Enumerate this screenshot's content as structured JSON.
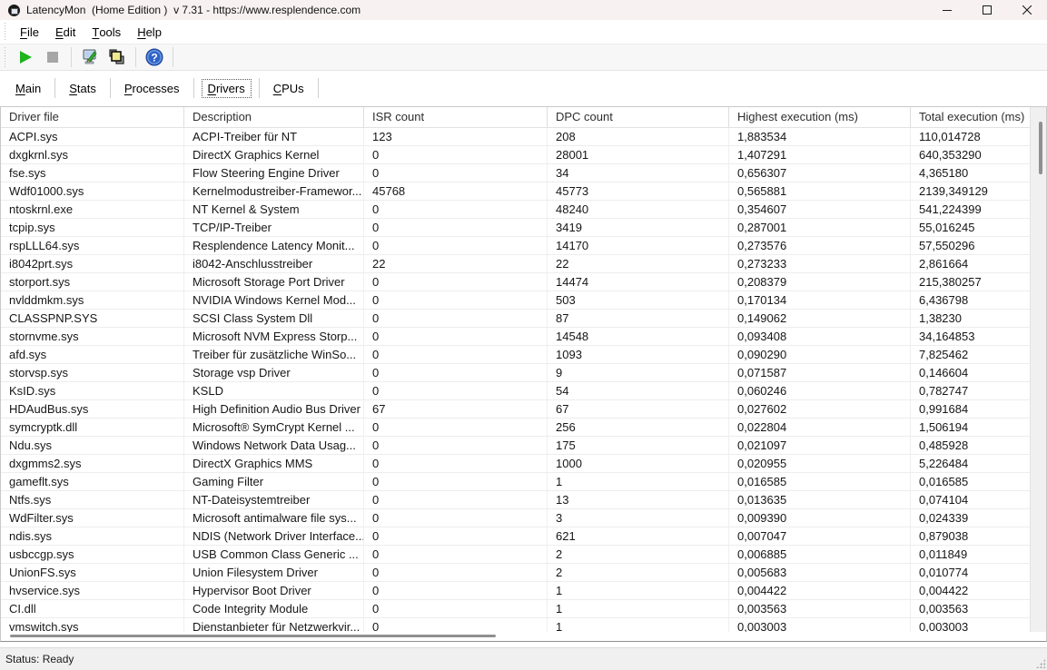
{
  "window": {
    "title": "LatencyMon  (Home Edition )  v 7.31 - https://www.resplendence.com"
  },
  "menubar": {
    "items": [
      {
        "label": "File"
      },
      {
        "label": "Edit"
      },
      {
        "label": "Tools"
      },
      {
        "label": "Help"
      }
    ]
  },
  "toolbar": {
    "buttons": [
      "start-monitor",
      "stop-monitor",
      "options",
      "report",
      "help"
    ],
    "colors": {
      "play_green": "#1eb41e",
      "stop_gray": "#a6a6a6",
      "help_blue": "#2e63c8",
      "report_yellow": "#f0e98f"
    }
  },
  "tabs": [
    {
      "label": "Main",
      "active": false
    },
    {
      "label": "Stats",
      "active": false
    },
    {
      "label": "Processes",
      "active": false
    },
    {
      "label": "Drivers",
      "active": true
    },
    {
      "label": "CPUs",
      "active": false
    }
  ],
  "table": {
    "columns": [
      "Driver file",
      "Description",
      "ISR count",
      "DPC count",
      "Highest execution (ms)",
      "Total execution (ms)"
    ],
    "rows": [
      [
        "ACPI.sys",
        "ACPI-Treiber für NT",
        "123",
        "208",
        "1,883534",
        "110,014728"
      ],
      [
        "dxgkrnl.sys",
        "DirectX Graphics Kernel",
        "0",
        "28001",
        "1,407291",
        "640,353290"
      ],
      [
        "fse.sys",
        "Flow Steering Engine Driver",
        "0",
        "34",
        "0,656307",
        "4,365180"
      ],
      [
        "Wdf01000.sys",
        "Kernelmodustreiber-Framewor...",
        "45768",
        "45773",
        "0,565881",
        "2139,349129"
      ],
      [
        "ntoskrnl.exe",
        "NT Kernel & System",
        "0",
        "48240",
        "0,354607",
        "541,224399"
      ],
      [
        "tcpip.sys",
        "TCP/IP-Treiber",
        "0",
        "3419",
        "0,287001",
        "55,016245"
      ],
      [
        "rspLLL64.sys",
        "Resplendence Latency Monit...",
        "0",
        "14170",
        "0,273576",
        "57,550296"
      ],
      [
        "i8042prt.sys",
        "i8042-Anschlusstreiber",
        "22",
        "22",
        "0,273233",
        "2,861664"
      ],
      [
        "storport.sys",
        "Microsoft Storage Port Driver",
        "0",
        "14474",
        "0,208379",
        "215,380257"
      ],
      [
        "nvlddmkm.sys",
        "NVIDIA Windows Kernel Mod...",
        "0",
        "503",
        "0,170134",
        "6,436798"
      ],
      [
        "CLASSPNP.SYS",
        "SCSI Class System Dll",
        "0",
        "87",
        "0,149062",
        "1,38230"
      ],
      [
        "stornvme.sys",
        "Microsoft NVM Express Storp...",
        "0",
        "14548",
        "0,093408",
        "34,164853"
      ],
      [
        "afd.sys",
        "Treiber für zusätzliche WinSo...",
        "0",
        "1093",
        "0,090290",
        "7,825462"
      ],
      [
        "storvsp.sys",
        "Storage vsp Driver",
        "0",
        "9",
        "0,071587",
        "0,146604"
      ],
      [
        "KsID.sys",
        "KSLD",
        "0",
        "54",
        "0,060246",
        "0,782747"
      ],
      [
        "HDAudBus.sys",
        "High Definition Audio Bus Driver",
        "67",
        "67",
        "0,027602",
        "0,991684"
      ],
      [
        "symcryptk.dll",
        "Microsoft® SymCrypt Kernel ...",
        "0",
        "256",
        "0,022804",
        "1,506194"
      ],
      [
        "Ndu.sys",
        "Windows Network Data Usag...",
        "0",
        "175",
        "0,021097",
        "0,485928"
      ],
      [
        "dxgmms2.sys",
        "DirectX Graphics MMS",
        "0",
        "1000",
        "0,020955",
        "5,226484"
      ],
      [
        "gameflt.sys",
        "Gaming Filter",
        "0",
        "1",
        "0,016585",
        "0,016585"
      ],
      [
        "Ntfs.sys",
        "NT-Dateisystemtreiber",
        "0",
        "13",
        "0,013635",
        "0,074104"
      ],
      [
        "WdFilter.sys",
        "Microsoft antimalware file sys...",
        "0",
        "3",
        "0,009390",
        "0,024339"
      ],
      [
        "ndis.sys",
        "NDIS (Network Driver Interface...",
        "0",
        "621",
        "0,007047",
        "0,879038"
      ],
      [
        "usbccgp.sys",
        "USB Common Class Generic ...",
        "0",
        "2",
        "0,006885",
        "0,011849"
      ],
      [
        "UnionFS.sys",
        "Union Filesystem Driver",
        "0",
        "2",
        "0,005683",
        "0,010774"
      ],
      [
        "hvservice.sys",
        "Hypervisor Boot Driver",
        "0",
        "1",
        "0,004422",
        "0,004422"
      ],
      [
        "CI.dll",
        "Code Integrity Module",
        "0",
        "1",
        "0,003563",
        "0,003563"
      ],
      [
        "vmswitch.sys",
        "Dienstanbieter für Netzwerkvir...",
        "0",
        "1",
        "0,003003",
        "0,003003"
      ]
    ]
  },
  "statusbar": {
    "text": "Status: Ready"
  }
}
